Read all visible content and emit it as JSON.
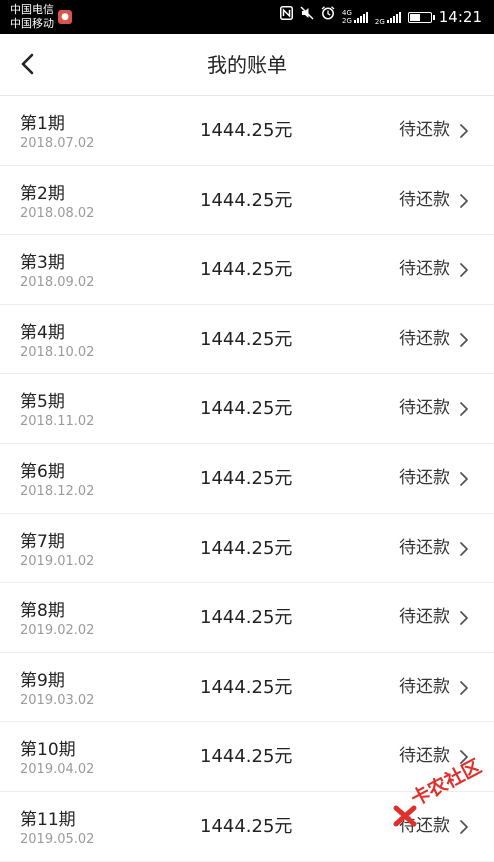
{
  "status_bar": {
    "carrier_1": "中国电信",
    "carrier_2": "中国移动",
    "net_tag_1": "4G",
    "net_tag_1b": "2G",
    "net_tag_2": "2G",
    "time": "14:21",
    "battery_level": 0.55
  },
  "header": {
    "title": "我的账单"
  },
  "bills": [
    {
      "period": "第1期",
      "date": "2018.07.02",
      "amount": "1444.25元",
      "status": "待还款"
    },
    {
      "period": "第2期",
      "date": "2018.08.02",
      "amount": "1444.25元",
      "status": "待还款"
    },
    {
      "period": "第3期",
      "date": "2018.09.02",
      "amount": "1444.25元",
      "status": "待还款"
    },
    {
      "period": "第4期",
      "date": "2018.10.02",
      "amount": "1444.25元",
      "status": "待还款"
    },
    {
      "period": "第5期",
      "date": "2018.11.02",
      "amount": "1444.25元",
      "status": "待还款"
    },
    {
      "period": "第6期",
      "date": "2018.12.02",
      "amount": "1444.25元",
      "status": "待还款"
    },
    {
      "period": "第7期",
      "date": "2019.01.02",
      "amount": "1444.25元",
      "status": "待还款"
    },
    {
      "period": "第8期",
      "date": "2019.02.02",
      "amount": "1444.25元",
      "status": "待还款"
    },
    {
      "period": "第9期",
      "date": "2019.03.02",
      "amount": "1444.25元",
      "status": "待还款"
    },
    {
      "period": "第10期",
      "date": "2019.04.02",
      "amount": "1444.25元",
      "status": "待还款"
    },
    {
      "period": "第11期",
      "date": "2019.05.02",
      "amount": "1444.25元",
      "status": "待还款"
    }
  ],
  "watermark": {
    "text": "卡农社区"
  },
  "colors": {
    "status_bar_bg": "#000000",
    "divider": "#ececec",
    "date_gray": "#9a9a9a",
    "watermark_red": "#e0302c"
  },
  "icons": {
    "back": "back-arrow-icon",
    "chevron": "chevron-right-icon",
    "nfc": "nfc-icon",
    "mute": "mute-icon",
    "alarm": "alarm-icon",
    "battery": "battery-icon"
  }
}
